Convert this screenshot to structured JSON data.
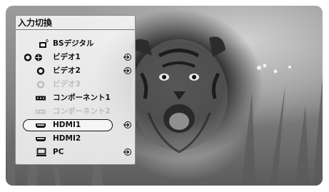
{
  "menu": {
    "title": "入力切換",
    "items": [
      {
        "label": "BSデジタル",
        "icon": "bs-digital-icon",
        "selected": false,
        "disabled": false,
        "has_arrow": false
      },
      {
        "label": "ビデオ1",
        "icon": "video1-icon",
        "selected": false,
        "disabled": false,
        "has_arrow": true
      },
      {
        "label": "ビデオ2",
        "icon": "video2-icon",
        "selected": false,
        "disabled": false,
        "has_arrow": true
      },
      {
        "label": "ビデオ3",
        "icon": "video3-icon",
        "selected": false,
        "disabled": true,
        "has_arrow": false
      },
      {
        "label": "コンポーネント1",
        "icon": "component1-icon",
        "selected": false,
        "disabled": false,
        "has_arrow": false
      },
      {
        "label": "コンポーネント2",
        "icon": "component2-icon",
        "selected": false,
        "disabled": true,
        "has_arrow": false
      },
      {
        "label": "HDMI1",
        "icon": "hdmi1-icon",
        "selected": true,
        "disabled": false,
        "has_arrow": true
      },
      {
        "label": "HDMI2",
        "icon": "hdmi2-icon",
        "selected": false,
        "disabled": false,
        "has_arrow": false
      },
      {
        "label": "PC",
        "icon": "pc-icon",
        "selected": false,
        "disabled": false,
        "has_arrow": true
      }
    ]
  },
  "colors": {
    "panel_bg": "#ffffff",
    "text": "#111111",
    "disabled_text": "#bdbdbd"
  }
}
